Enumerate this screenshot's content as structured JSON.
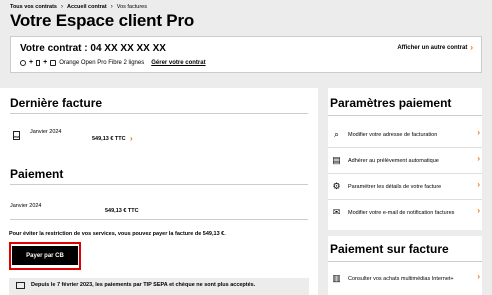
{
  "breadcrumb": {
    "items": [
      "Tous vos contrats",
      "Accueil contrat",
      "Vos factures"
    ]
  },
  "page_title": "Votre Espace client Pro",
  "contract": {
    "title": "Votre contrat : 04 XX XX XX XX",
    "show_other": "Afficher un autre contrat",
    "offer": "Orange Open Pro Fibre 2 lignes",
    "see_contract": "Gérer votre contrat"
  },
  "last_invoice": {
    "heading": "Dernière facture",
    "date": "Janvier 2024",
    "amount": "549,13 € TTC"
  },
  "payment": {
    "heading": "Paiement",
    "date": "Janvier 2024",
    "amount": "549,13 € TTC",
    "restriction_text": "Pour éviter la restriction de vos services, vous pouvez payer la facture de 549,13 €.",
    "pay_button": "Payer par CB",
    "notice": "Depuis le 7 février 2023, les paiements par TIP SEPA et chèque ne sont plus acceptés."
  },
  "payment_settings": {
    "heading": "Paramètres paiement",
    "items": [
      {
        "label": "Modifier votre adresse de facturation",
        "icon": "magnifier-icon"
      },
      {
        "label": "Adhérer au prélèvement automatique",
        "icon": "document-icon"
      },
      {
        "label": "Paramétrer les détails de votre facture",
        "icon": "gear-icon"
      },
      {
        "label": "Modifier votre e-mail de notification factures",
        "icon": "envelope-icon"
      }
    ]
  },
  "invoice_payment": {
    "heading": "Paiement sur facture",
    "items": [
      {
        "label": "Consulter vos achats multimédias Internet+",
        "icon": "cart-icon"
      }
    ]
  },
  "colors": {
    "accent": "#f16e00",
    "highlight": "#e00000",
    "button": "#000000"
  }
}
